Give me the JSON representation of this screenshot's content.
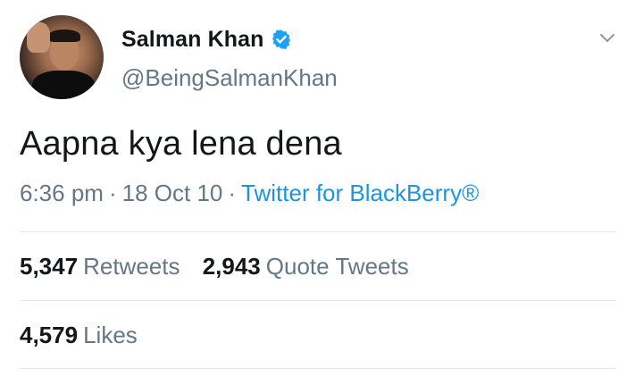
{
  "user": {
    "display_name": "Salman Khan",
    "handle": "@BeingSalmanKhan",
    "verified": true
  },
  "tweet": {
    "text": "Aapna kya lena dena",
    "time": "6:36 pm",
    "date": "18 Oct 10",
    "separator": "·",
    "source": "Twitter for BlackBerry®"
  },
  "stats": {
    "retweets_count": "5,347",
    "retweets_label": "Retweets",
    "quote_count": "2,943",
    "quote_label": "Quote Tweets",
    "likes_count": "4,579",
    "likes_label": "Likes"
  },
  "colors": {
    "accent": "#1b95e0",
    "verified_badge": "#1da1f2",
    "text_primary": "#14171a",
    "text_secondary": "#657786",
    "divider": "#e1e8ed"
  },
  "icons": {
    "verified": "verified-badge-icon",
    "menu": "chevron-down-icon"
  }
}
